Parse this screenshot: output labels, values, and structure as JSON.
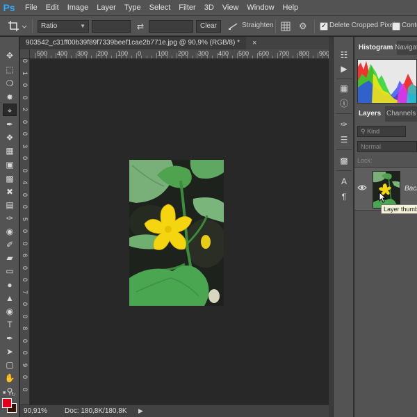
{
  "app": {
    "logo": "Ps"
  },
  "menu": [
    "File",
    "Edit",
    "Image",
    "Layer",
    "Type",
    "Select",
    "Filter",
    "3D",
    "View",
    "Window",
    "Help"
  ],
  "options": {
    "crop_tool_icon": "crop-icon",
    "ratio_value": "Ratio",
    "clear_label": "Clear",
    "straighten_label": "Straighten",
    "delete_cropped_label": "Delete Cropped Pixels",
    "content_aware_label": "Conte"
  },
  "document": {
    "tab_title": "903542_c31ff00b39f89f7339beef1cae2b771e.jpg @ 90,9% (RGB/8) *",
    "ruler_top_labels": [
      "500",
      "400",
      "300",
      "200",
      "100",
      "0",
      "100",
      "200",
      "300",
      "400",
      "500",
      "600",
      "700",
      "800",
      "900"
    ],
    "ruler_left_labels": [
      "0",
      "1",
      "0",
      "0",
      "2",
      "0",
      "0",
      "3",
      "0",
      "0",
      "4",
      "0",
      "0",
      "5",
      "0",
      "0",
      "6",
      "0",
      "0",
      "7",
      "0",
      "0",
      "8",
      "0",
      "0",
      "9",
      "0",
      "0"
    ]
  },
  "status": {
    "zoom": "90,91%",
    "doc_info": "Doc: 180,8K/180,8K"
  },
  "panels": {
    "histogram_tab": "Histogram",
    "navigator_tab": "Navigat",
    "layers_tab": "Layers",
    "channels_tab": "Channels",
    "kind_label": "Kind",
    "blend_mode": "Normal",
    "lock_label": "Lock:",
    "layer_name": "Back",
    "tooltip": "Layer thumbn"
  },
  "colors": {
    "foreground": "#e0001b",
    "background": "#3a1000",
    "accent": "#31a8ff"
  }
}
